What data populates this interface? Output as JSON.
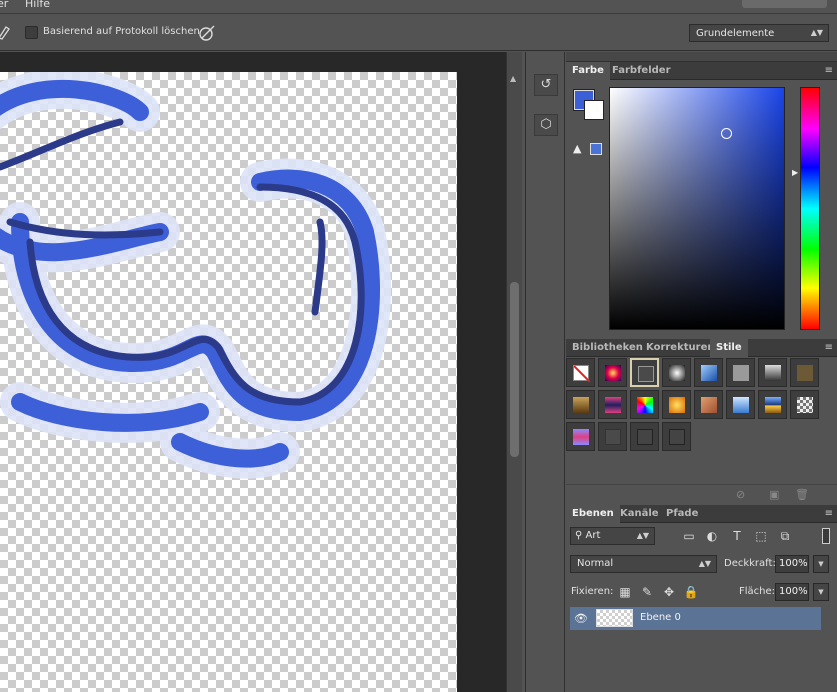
{
  "menu": {
    "items": [
      "er",
      "Hilfe"
    ]
  },
  "options_bar": {
    "protocol_checkbox_label": "Basierend auf Protokoll löschen",
    "protocol_checked": false,
    "workspace_value": "Grundelemente"
  },
  "color_panel": {
    "tabs": [
      "Farbe",
      "Farbfelder"
    ],
    "active_tab": "Farbe",
    "foreground_color": "#3b5fd6",
    "background_color": "#ffffff"
  },
  "styles_panel": {
    "tabs": [
      "Bibliotheken",
      "Korrekturen",
      "Stile"
    ],
    "active_tab": "Stile"
  },
  "layers_panel": {
    "tabs": [
      "Ebenen",
      "Kanäle",
      "Pfade"
    ],
    "active_tab": "Ebenen",
    "filter_value": "Art",
    "blend_mode": "Normal",
    "opacity_label": "Deckkraft:",
    "opacity_value": "100%",
    "lock_label": "Fixieren:",
    "fill_label": "Fläche:",
    "fill_value": "100%",
    "layers": [
      {
        "name": "Ebene 0",
        "visible": true,
        "selected": true
      }
    ]
  },
  "icons": {
    "eraser_tool": "eraser-icon",
    "airbrush": "airbrush-icon",
    "history": "history-icon",
    "3d": "3d-icon",
    "eye": "eye-icon"
  }
}
